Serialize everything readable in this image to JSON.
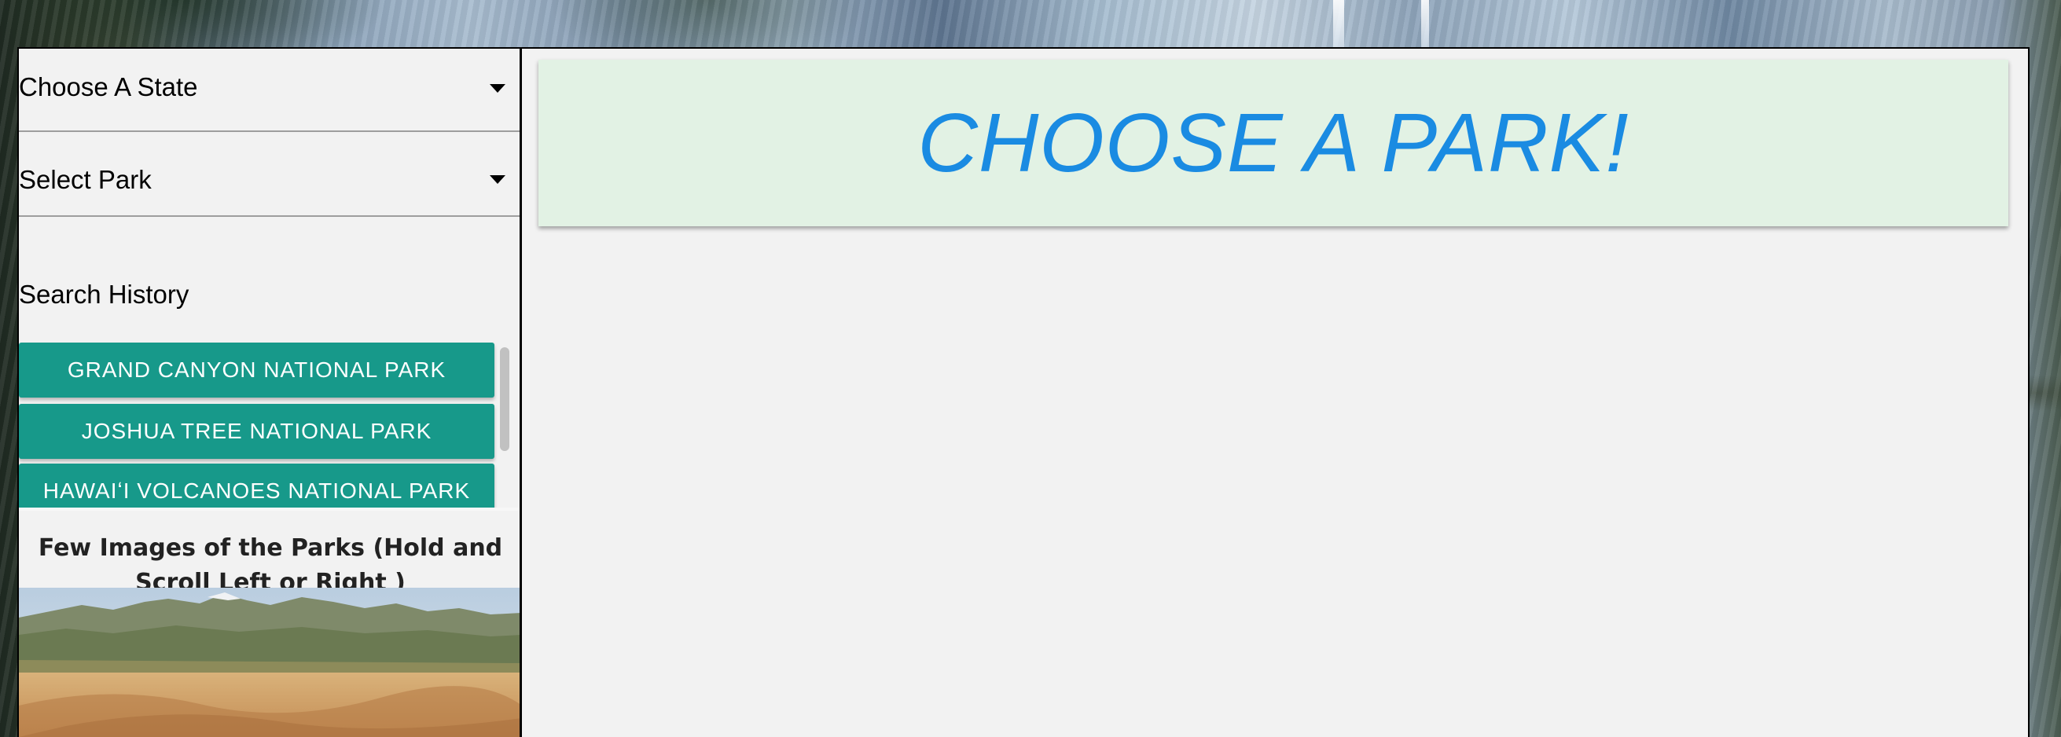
{
  "sidebar": {
    "state_select": {
      "value": "Choose A State"
    },
    "park_select": {
      "value": "Select Park"
    },
    "search_history": {
      "label": "Search History",
      "items": [
        "GRAND CANYON NATIONAL PARK",
        "JOSHUA TREE NATIONAL PARK",
        "HAWAIʻI VOLCANOES NATIONAL PARK"
      ]
    },
    "images_heading": "Few Images of the Parks (Hold and Scroll Left or Right )"
  },
  "main": {
    "title": "CHOOSE A PARK!"
  },
  "colors": {
    "history_button": "#17998a",
    "title_card_bg": "#e2f2e4",
    "title_text": "#1a8be2",
    "panel_bg": "#f2f2f2"
  }
}
